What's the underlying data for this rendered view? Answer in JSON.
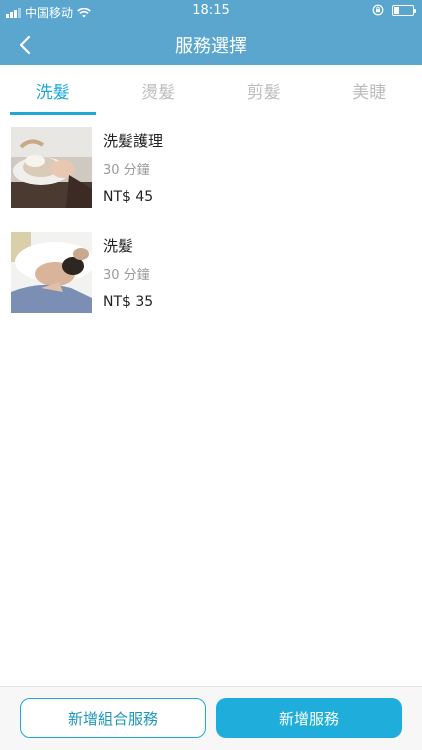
{
  "status_bar": {
    "carrier": "中国移动",
    "time": "18:15",
    "battery_level": 0.3
  },
  "header": {
    "title": "服務選擇"
  },
  "tabs": [
    {
      "label": "洗髮",
      "active": true
    },
    {
      "label": "燙髮",
      "active": false
    },
    {
      "label": "剪髮",
      "active": false
    },
    {
      "label": "美睫",
      "active": false
    }
  ],
  "services": [
    {
      "name": "洗髮護理",
      "duration": "30 分鐘",
      "price": "NT$ 45"
    },
    {
      "name": "洗髮",
      "duration": "30 分鐘",
      "price": "NT$ 35"
    }
  ],
  "footer": {
    "add_combo_label": "新增組合服務",
    "add_service_label": "新增服務"
  },
  "colors": {
    "header_bg": "#5aa6cf",
    "accent": "#20a8d4",
    "tab_inactive": "#bdbdbd",
    "muted_text": "#9a9a9a"
  },
  "icons": {
    "back": "chevron-left-icon",
    "signal": "signal-icon",
    "wifi": "wifi-icon",
    "rotation_lock": "rotation-lock-icon",
    "battery": "battery-icon"
  }
}
